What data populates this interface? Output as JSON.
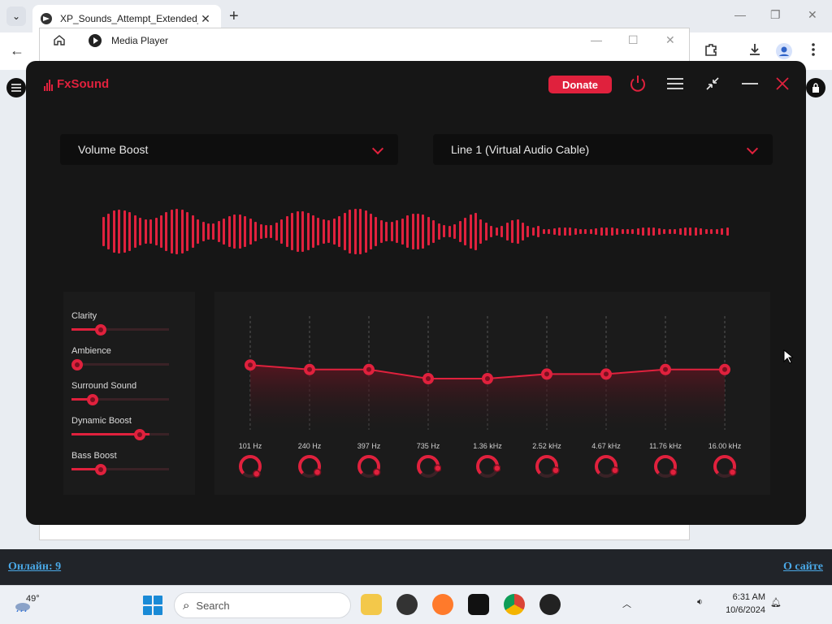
{
  "browser": {
    "tab_title": "XP_Sounds_Attempt_Extended_",
    "new_tab": "+",
    "tab_close": "✕",
    "tab_list": "⌄",
    "back": "←",
    "media_window_title": "Media Player"
  },
  "site": {
    "online_link": "Онлайн: 9",
    "about_link": "О сайте"
  },
  "fxsound": {
    "brand": "FxSound",
    "donate_label": "Donate",
    "preset": "Volume Boost",
    "output_device": "Line 1 (Virtual Audio Cable)",
    "effects": [
      {
        "label": "Clarity",
        "level": 0.3
      },
      {
        "label": "Ambience",
        "level": 0.0
      },
      {
        "label": "Surround Sound",
        "level": 0.2
      },
      {
        "label": "Dynamic Boost",
        "level": 0.8
      },
      {
        "label": "Bass Boost",
        "level": 0.3
      }
    ],
    "eq_bands": [
      {
        "freq": "101 Hz",
        "level": 0.57
      },
      {
        "freq": "240 Hz",
        "level": 0.53
      },
      {
        "freq": "397 Hz",
        "level": 0.53
      },
      {
        "freq": "735 Hz",
        "level": 0.45
      },
      {
        "freq": "1.36 kHz",
        "level": 0.45
      },
      {
        "freq": "2.52 kHz",
        "level": 0.49
      },
      {
        "freq": "4.67 kHz",
        "level": 0.49
      },
      {
        "freq": "11.76 kHz",
        "level": 0.53
      },
      {
        "freq": "16.00 kHz",
        "level": 0.53
      }
    ],
    "colors": {
      "accent": "#e0213d",
      "bg": "#161616",
      "panel": "#1b1b1b"
    }
  },
  "taskbar": {
    "weather_temp": "49°",
    "search_placeholder": "Search",
    "time": "6:31 AM",
    "date": "10/6/2024"
  }
}
